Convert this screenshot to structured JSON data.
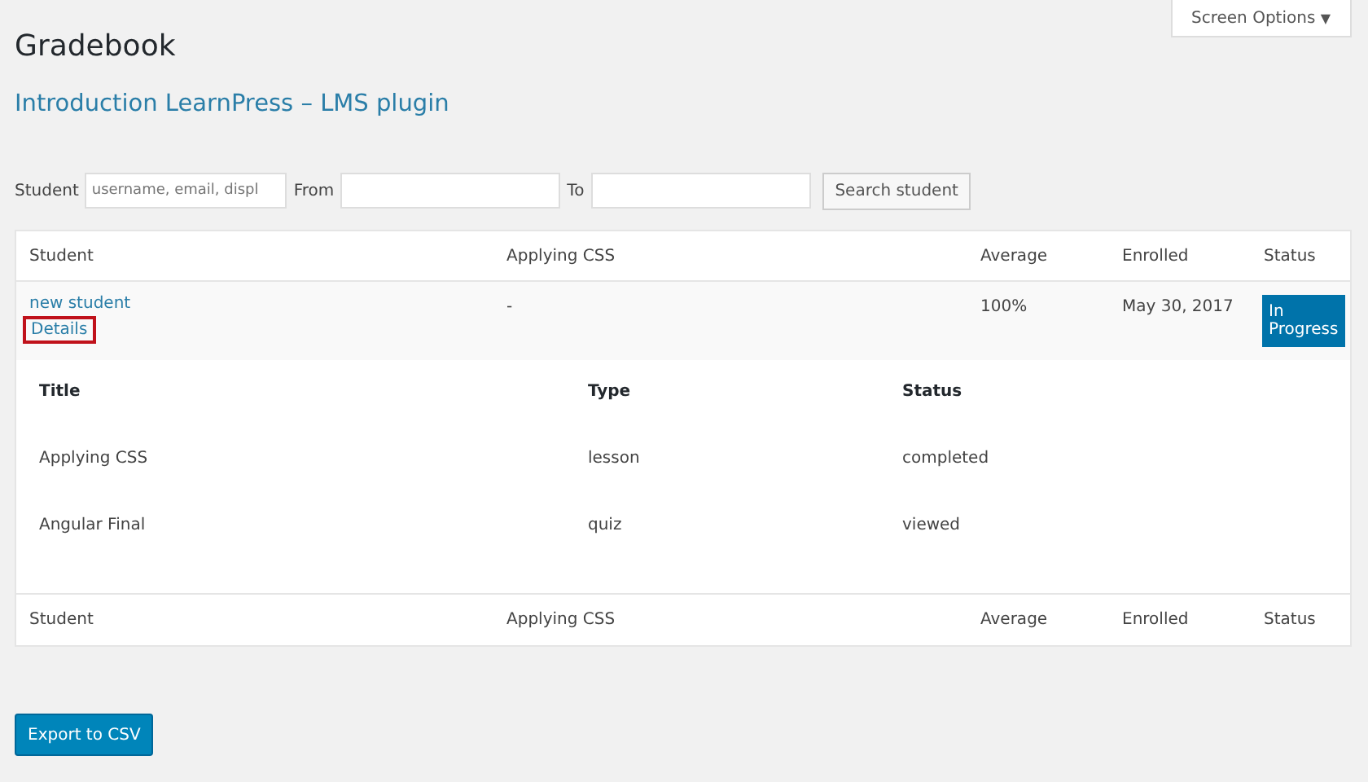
{
  "screen_options": {
    "label": "Screen Options",
    "caret": "▼"
  },
  "title": "Gradebook",
  "course_link": "Introduction LearnPress – LMS plugin",
  "filters": {
    "student_label": "Student",
    "student_placeholder": "username, email, displ",
    "from_label": "From",
    "to_label": "To",
    "search_button": "Search student"
  },
  "table": {
    "columns": [
      "Student",
      "Applying CSS",
      "Average",
      "Enrolled",
      "Status"
    ],
    "rows": [
      {
        "student": "new student",
        "details": "Details",
        "details_highlighted": true,
        "applying_css": "-",
        "average": "100%",
        "enrolled": "May 30, 2017",
        "status": "In Progress"
      }
    ],
    "details": {
      "columns": [
        "Title",
        "Type",
        "Status"
      ],
      "rows": [
        [
          "Applying CSS",
          "lesson",
          "completed"
        ],
        [
          "Angular Final",
          "quiz",
          "viewed"
        ]
      ]
    },
    "footer": [
      "Student",
      "Applying CSS",
      "Average",
      "Enrolled",
      "Status"
    ]
  },
  "export_button": "Export to CSV"
}
